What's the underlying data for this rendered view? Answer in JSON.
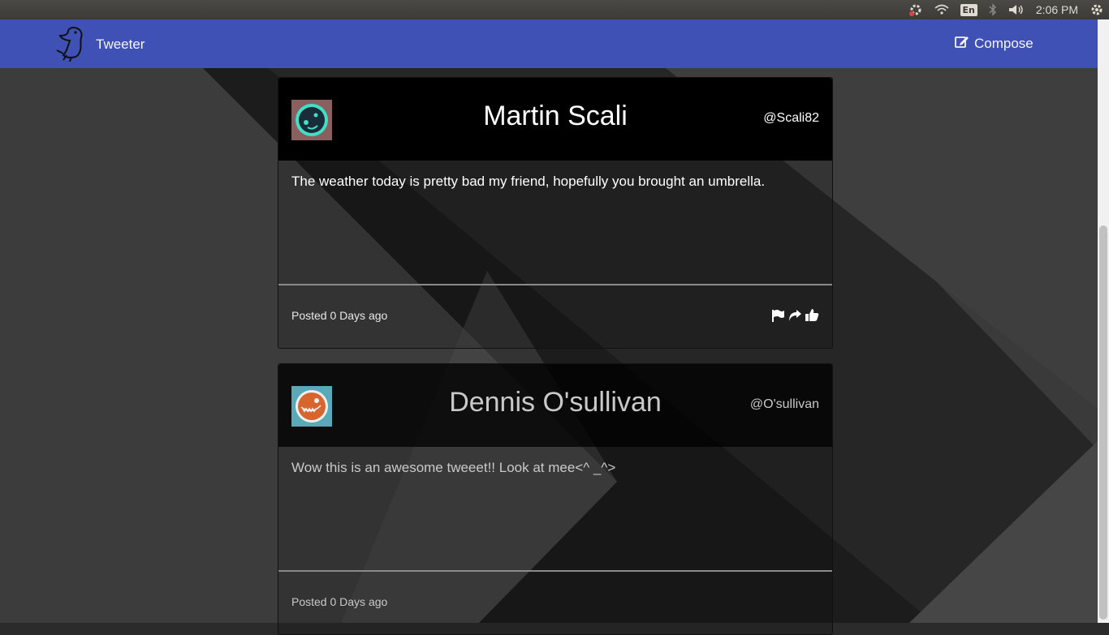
{
  "app": {
    "brand_name": "Tweeter",
    "compose_label": "Compose"
  },
  "os_bar": {
    "language": "En",
    "clock": "2:06 PM"
  },
  "tweets": [
    {
      "name": "Martin Scali",
      "handle": "@Scali82",
      "text": "The weather today is pretty bad my friend, hopefully you brought an umbrella.",
      "posted_prefix": "Posted",
      "posted_age": "0 Days ago",
      "avatar_icon": "teal-face-avatar-icon",
      "avatar_colors": {
        "bg": "#8a5f5f",
        "ring": "#3fe0c5",
        "face": "#1a2c3a"
      }
    },
    {
      "name": "Dennis O'sullivan",
      "handle": "@O'sullivan",
      "text": "Wow this is an awesome tweeet!! Look at mee<^ _^>",
      "posted_prefix": "Posted",
      "posted_age": "0 Days ago",
      "avatar_icon": "orange-face-avatar-icon",
      "avatar_colors": {
        "bg": "#5aa9b8",
        "ring": "#f0f0f0",
        "face": "#d9652e"
      }
    }
  ],
  "actions": [
    "flag-icon",
    "share-icon",
    "like-icon"
  ],
  "colors": {
    "navbar": "#3f51b5",
    "card_header": "#000000"
  }
}
